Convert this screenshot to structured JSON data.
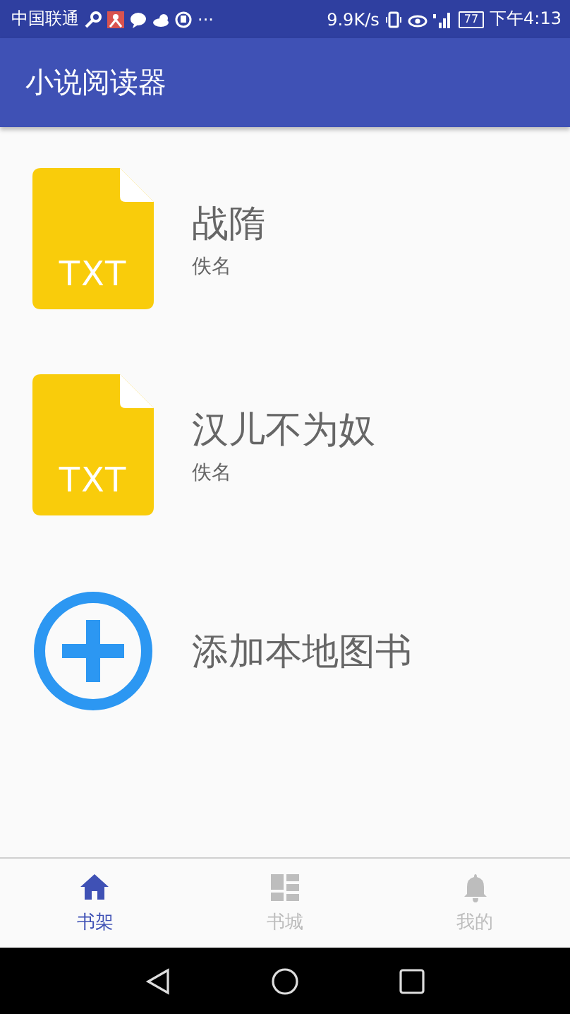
{
  "status_bar": {
    "carrier": "中国联通",
    "more": "···",
    "speed": "9.9K/s",
    "battery": "77",
    "time": "下午4:13"
  },
  "app_bar": {
    "title": "小说阅读器"
  },
  "shelf": [
    {
      "kind": "book",
      "badge": "TXT",
      "title": "战隋",
      "author": "佚名"
    },
    {
      "kind": "book",
      "badge": "TXT",
      "title": "汉儿不为奴",
      "author": "佚名"
    },
    {
      "kind": "add",
      "title": "添加本地图书"
    }
  ],
  "tabs": [
    {
      "label": "书架",
      "selected": true
    },
    {
      "label": "书城",
      "selected": false
    },
    {
      "label": "我的",
      "selected": false
    }
  ]
}
